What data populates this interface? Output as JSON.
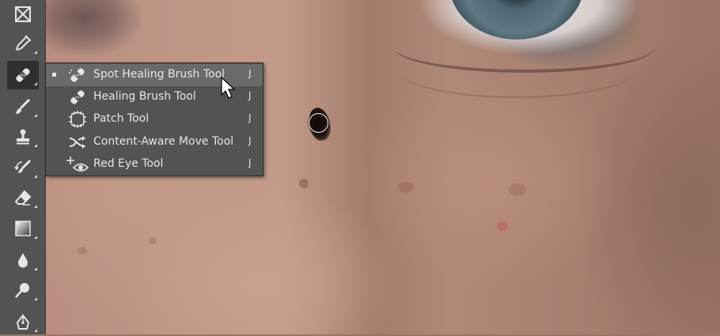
{
  "toolbar": {
    "tools": [
      {
        "name": "frame-tool",
        "icon": "frame-icon",
        "active": false
      },
      {
        "name": "eyedropper-tool",
        "icon": "eyedropper-icon",
        "active": false
      },
      {
        "name": "spot-healing-brush-tool",
        "icon": "bandage-icon",
        "active": true
      },
      {
        "name": "brush-tool",
        "icon": "brush-icon",
        "active": false
      },
      {
        "name": "clone-stamp-tool",
        "icon": "stamp-icon",
        "active": false
      },
      {
        "name": "history-brush-tool",
        "icon": "history-brush-icon",
        "active": false
      },
      {
        "name": "eraser-tool",
        "icon": "eraser-icon",
        "active": false
      },
      {
        "name": "gradient-tool",
        "icon": "gradient-icon",
        "active": false
      },
      {
        "name": "blur-tool",
        "icon": "drop-icon",
        "active": false
      },
      {
        "name": "dodge-tool",
        "icon": "dodge-icon",
        "active": false
      },
      {
        "name": "pen-tool",
        "icon": "pen-icon",
        "active": false
      }
    ]
  },
  "flyout": {
    "items": [
      {
        "label": "Spot Healing Brush Tool",
        "shortcut": "J",
        "icon": "spot-healing-icon",
        "selected": true,
        "hovered": true
      },
      {
        "label": "Healing Brush Tool",
        "shortcut": "J",
        "icon": "bandage-icon",
        "selected": false,
        "hovered": false
      },
      {
        "label": "Patch Tool",
        "shortcut": "J",
        "icon": "patch-icon",
        "selected": false,
        "hovered": false
      },
      {
        "label": "Content-Aware Move Tool",
        "shortcut": "J",
        "icon": "content-aware-move-icon",
        "selected": false,
        "hovered": false
      },
      {
        "label": "Red Eye Tool",
        "shortcut": "J",
        "icon": "red-eye-icon",
        "selected": false,
        "hovered": false
      }
    ]
  },
  "colors": {
    "panel": "#535353",
    "highlight": "#6a6a6a",
    "text": "#e6e6e6"
  }
}
